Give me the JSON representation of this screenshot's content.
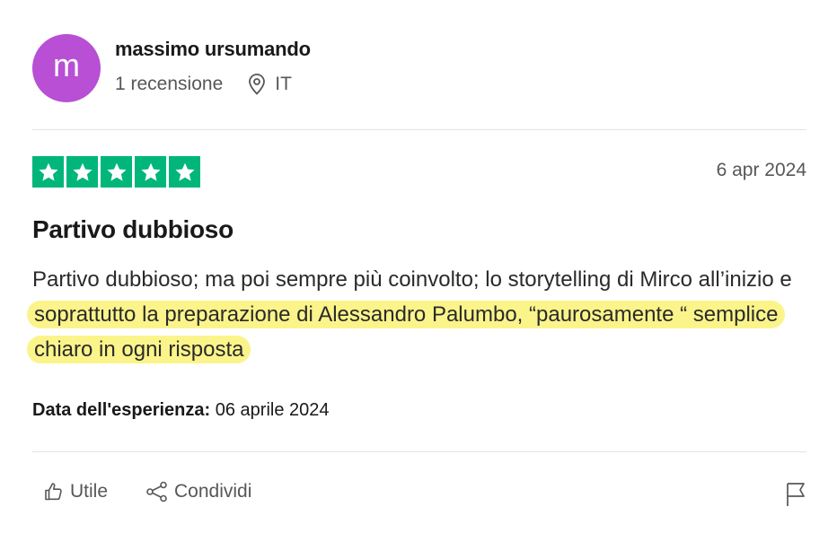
{
  "reviewer": {
    "initial": "m",
    "name": "massimo ursumando",
    "review_count": "1 recensione",
    "country": "IT",
    "avatar_color": "#b84fd4"
  },
  "rating": {
    "stars": 5,
    "max_stars": 5,
    "color": "#00b67a"
  },
  "review": {
    "date": "6 apr 2024",
    "title": "Partivo dubbioso",
    "body_plain": "Partivo dubbioso; ma poi sempre più coinvolto; lo storytelling di Mirco all’inizio e ",
    "body_highlighted": "soprattutto la preparazione di Alessandro Palumbo, “paurosamente “ semplice chiaro in ogni risposta",
    "highlight_color": "#fbf48a",
    "experience_label": "Data dell'esperienza:",
    "experience_date": "06 aprile 2024"
  },
  "actions": {
    "useful_label": "Utile",
    "share_label": "Condividi",
    "useful_icon": "thumbs-up-icon",
    "share_icon": "share-icon",
    "report_icon": "flag-icon"
  }
}
